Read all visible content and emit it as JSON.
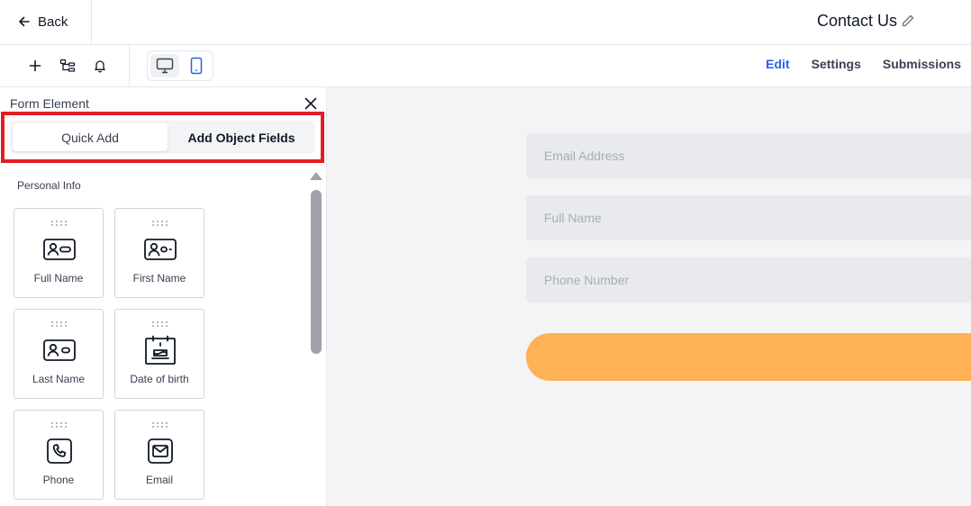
{
  "header": {
    "back_label": "Back",
    "title": "Contact Us"
  },
  "toolbar": {
    "icons": [
      "plus-icon",
      "hierarchy-icon",
      "bell-icon"
    ],
    "devices": [
      "desktop-icon",
      "mobile-icon"
    ],
    "active_device": "mobile",
    "tabs": [
      {
        "label": "Edit",
        "active": true
      },
      {
        "label": "Settings",
        "active": false
      },
      {
        "label": "Submissions",
        "active": false
      }
    ]
  },
  "panel": {
    "title": "Form Element",
    "tabs": [
      {
        "label": "Quick Add",
        "selected": true
      },
      {
        "label": "Add Object Fields",
        "selected": false
      }
    ],
    "section": "Personal Info",
    "elements": [
      {
        "label": "Full Name",
        "icon": "id-card-icon"
      },
      {
        "label": "First Name",
        "icon": "id-card-dash-icon"
      },
      {
        "label": "Last Name",
        "icon": "id-card-icon"
      },
      {
        "label": "Date of birth",
        "icon": "birthday-cake-icon"
      },
      {
        "label": "Phone",
        "icon": "phone-icon"
      },
      {
        "label": "Email",
        "icon": "envelope-icon"
      }
    ]
  },
  "canvas": {
    "fields": [
      {
        "placeholder": "Email Address"
      },
      {
        "placeholder": "Full Name"
      },
      {
        "placeholder": "Phone Number"
      }
    ]
  },
  "colors": {
    "accent": "#2563eb",
    "highlight_box": "#e11d24",
    "submit_button": "#ffb156",
    "canvas_bg": "#f3f4f6"
  }
}
